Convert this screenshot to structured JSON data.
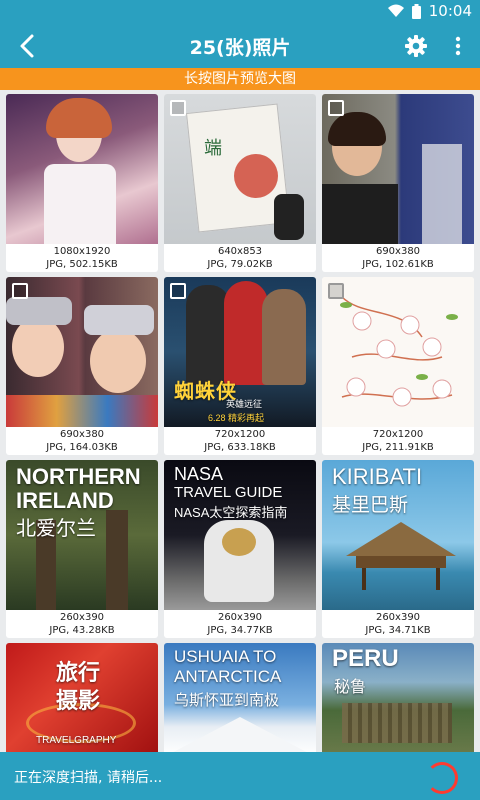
{
  "status_bar": {
    "time": "10:04"
  },
  "app_bar": {
    "title": "25(张)照片"
  },
  "banner": {
    "text": "长按图片预览大图"
  },
  "photos": [
    {
      "dims": "1080x1920",
      "info": "JPG, 502.15KB"
    },
    {
      "dims": "640x853",
      "info": "JPG, 79.02KB"
    },
    {
      "dims": "690x380",
      "info": "JPG, 102.61KB"
    },
    {
      "dims": "690x380",
      "info": "JPG, 164.03KB"
    },
    {
      "dims": "720x1200",
      "info": "JPG, 633.18KB",
      "poster_title": "蜘蛛侠",
      "poster_sub": "英雄远征",
      "poster_date": "6.28 精彩再起"
    },
    {
      "dims": "720x1200",
      "info": "JPG, 211.91KB"
    },
    {
      "dims": "260x390",
      "info": "JPG, 43.28KB",
      "overlay1": "NORTHERN",
      "overlay2": "IRELAND",
      "overlay3": "北爱尔兰"
    },
    {
      "dims": "260x390",
      "info": "JPG, 34.77KB",
      "overlay1": "NASA",
      "overlay2": "TRAVEL GUIDE",
      "overlay3": "NASA太空探索指南"
    },
    {
      "dims": "260x390",
      "info": "JPG, 34.71KB",
      "overlay1": "KIRIBATI",
      "overlay2": "基里巴斯"
    },
    {
      "overlay1": "旅行",
      "overlay2": "摄影",
      "overlay3": "TRAVELGRAPHY"
    },
    {
      "overlay1": "USHUAIA TO",
      "overlay2": "ANTARCTICA",
      "overlay3": "乌斯怀亚到南极"
    },
    {
      "overlay1": "PERU",
      "overlay2": "秘鲁"
    }
  ],
  "bottom_bar": {
    "scan_text": "正在深度扫描, 请稍后..."
  },
  "colors": {
    "primary": "#2aa0c0",
    "accent": "#f7941d",
    "spinner": "#ff3b30"
  }
}
